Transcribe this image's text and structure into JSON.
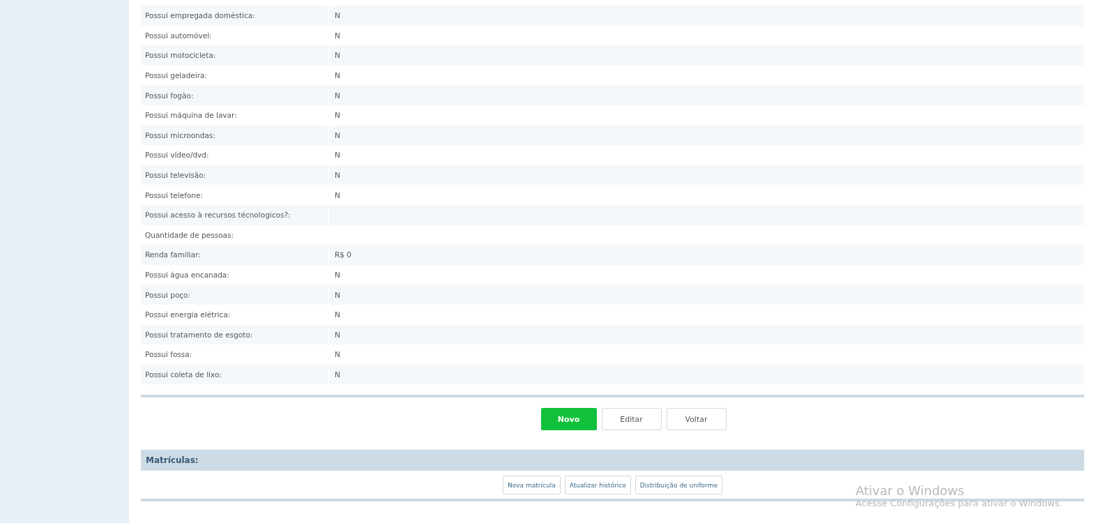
{
  "details": [
    {
      "label": "Possui empregada doméstica:",
      "value": "N"
    },
    {
      "label": "Possui automóvel:",
      "value": "N"
    },
    {
      "label": "Possui motocicleta:",
      "value": "N"
    },
    {
      "label": "Possui geladeira:",
      "value": "N"
    },
    {
      "label": "Possui fogão:",
      "value": "N"
    },
    {
      "label": "Possui máquina de lavar:",
      "value": "N"
    },
    {
      "label": "Possui microondas:",
      "value": "N"
    },
    {
      "label": "Possui vídeo/dvd:",
      "value": "N"
    },
    {
      "label": "Possui televisão:",
      "value": "N"
    },
    {
      "label": "Possui telefone:",
      "value": "N"
    },
    {
      "label": "Possui acesso à recursos técnologicos?:"
    },
    {
      "label": "Quantidade de pessoas:"
    },
    {
      "label": "Renda familiar:",
      "value": "R$ 0"
    },
    {
      "label": "Possui água encanada:",
      "value": "N"
    },
    {
      "label": "Possui poço:",
      "value": "N"
    },
    {
      "label": "Possui energia elétrica:",
      "value": "N"
    },
    {
      "label": "Possui tratamento de esgoto:",
      "value": "N"
    },
    {
      "label": "Possui fossa:",
      "value": "N"
    },
    {
      "label": "Possui coleta de lixo:",
      "value": "N"
    }
  ],
  "actions": [
    {
      "label": "Novo",
      "kind": "primary"
    },
    {
      "label": "Editar",
      "kind": "default"
    },
    {
      "label": "Voltar",
      "kind": "default"
    }
  ],
  "enrollments": {
    "title": "Matrículas:",
    "buttons": [
      "Nova matrícula",
      "Atualizar histórico",
      "Distribuição de uniforme"
    ]
  },
  "os_notice": {
    "title": "Ativar o Windows",
    "text": "Acesse Configurações para ativar o Windows."
  }
}
